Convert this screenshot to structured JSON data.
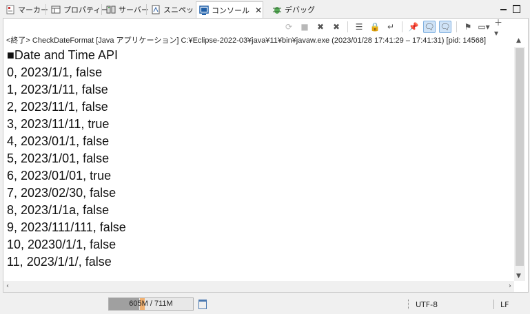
{
  "tabs": [
    {
      "label": "マーカー",
      "icon": "markers-icon"
    },
    {
      "label": "プロパティー",
      "icon": "properties-icon"
    },
    {
      "label": "サーバー",
      "icon": "servers-icon"
    },
    {
      "label": "スニペット",
      "icon": "snippets-icon"
    },
    {
      "label": "コンソール",
      "icon": "console-icon",
      "active": true
    },
    {
      "label": "デバッグ",
      "icon": "debug-icon"
    }
  ],
  "process_line": "<終了> CheckDateFormat [Java アプリケーション] C:¥Eclipse-2022-03¥java¥11¥bin¥javaw.exe  (2023/01/28 17:41:29 – 17:41:31) [pid: 14568]",
  "console_lines": [
    "■Date and Time API",
    "0, 2023/1/1, false",
    "1, 2023/1/11, false",
    "2, 2023/11/1, false",
    "3, 2023/11/11, true",
    "4, 2023/01/1, false",
    "5, 2023/1/01, false",
    "6, 2023/01/01, true",
    "7, 2023/02/30, false",
    "8, 2023/1/1a, false",
    "9, 2023/111/111, false",
    "10, 20230/1/1, false",
    "11, 2023/1/1/, false"
  ],
  "status": {
    "heap": "605M / 711M",
    "heap_fraction": 0.36,
    "encoding": "UTF-8",
    "line_ending": "LF"
  },
  "colors": {
    "heap_fill": "#a0a0a0",
    "toggle_on": "#cfe3f7",
    "accent": "#4a78b0"
  }
}
